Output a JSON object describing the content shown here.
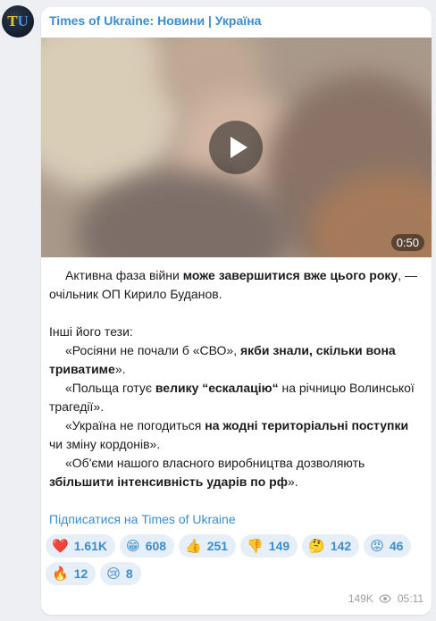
{
  "channel": {
    "name": "Times of Ukraine: Новини | Україна",
    "avatar_text_1": "T",
    "avatar_text_2": "U"
  },
  "video": {
    "duration": "0:50",
    "play_icon": "play-icon"
  },
  "post": {
    "p1_a": "Активна фаза війни ",
    "p1_b": "може завершитися вже цього року",
    "p1_c": ", — очільник ОП Кирило Буданов.",
    "p2": "Інші його тези:",
    "p3_a": "«Росіяни не почали б «СВО», ",
    "p3_b": "якби знали, скільки вона триватиме",
    "p3_c": "».",
    "p4_a": "«Польща готує ",
    "p4_b": "велику “ескалацію“",
    "p4_c": " на річницю Волинської трагедії».",
    "p5_a": "«Україна не погодиться ",
    "p5_b": "на жодні територіальні поступки",
    "p5_c": " чи зміну кордонів».",
    "p6_a": "«Об'єми нашого власного виробництва дозволяють ",
    "p6_b": "збільшити інтенсивність ударів по рф",
    "p6_c": "»."
  },
  "subscribe_link": "Підписатися на Times of Ukraine",
  "reactions": [
    {
      "icon": "❤️",
      "count": "1.61K"
    },
    {
      "icon": "😁",
      "count": "608"
    },
    {
      "icon": "👍",
      "count": "251"
    },
    {
      "icon": "👎",
      "count": "149"
    },
    {
      "icon": "🤔",
      "count": "142"
    },
    {
      "icon": "😡",
      "count": "46"
    },
    {
      "icon": "🔥",
      "count": "12"
    },
    {
      "icon": "😢",
      "count": "8"
    }
  ],
  "meta": {
    "views": "149K",
    "time": "05:11"
  },
  "colors": {
    "accent": "#3a8dd0",
    "reaction_bg": "#e6eef7",
    "background": "#eeeff2"
  }
}
